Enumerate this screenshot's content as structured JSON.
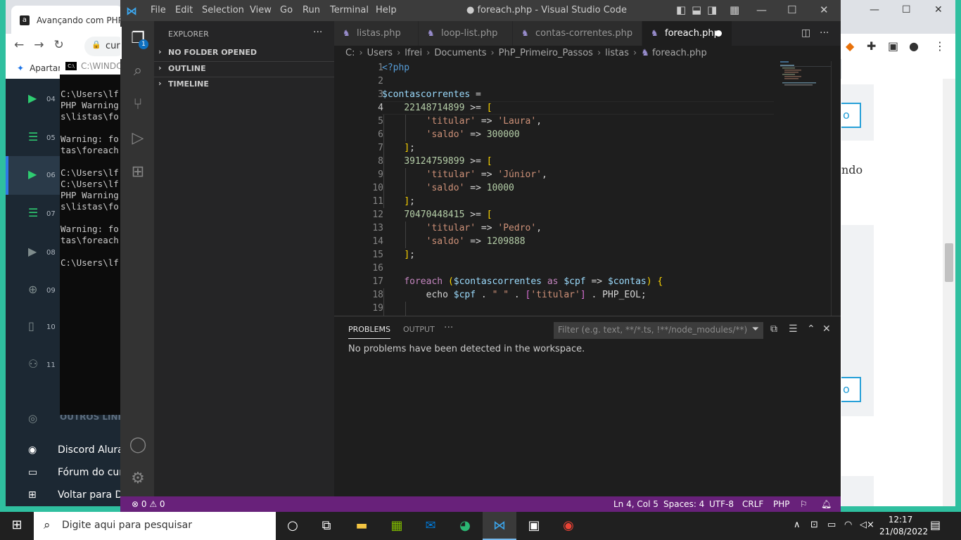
{
  "browser": {
    "tab_title": "Avançando com PHP: A",
    "tab_favicon": "a",
    "omnibox_text": "cur",
    "bookmark": "Apartar",
    "page_button": "o",
    "page_text": "ndo"
  },
  "course_sidebar": {
    "items": [
      {
        "num": "04",
        "icon": "play-icon"
      },
      {
        "num": "05",
        "icon": "list-icon"
      },
      {
        "num": "06",
        "icon": "play-icon"
      },
      {
        "num": "07",
        "icon": "list-icon"
      },
      {
        "num": "08",
        "icon": "play-icon"
      },
      {
        "num": "09",
        "icon": "plus-icon"
      },
      {
        "num": "10",
        "icon": "book-icon"
      },
      {
        "num": "11",
        "icon": "users-icon"
      }
    ],
    "outros": "OUTROS LINK",
    "links": [
      {
        "label": "Discord Alura",
        "icon": "discord-icon"
      },
      {
        "label": "Fórum do cur",
        "icon": "forum-icon"
      },
      {
        "label": "Voltar para Da",
        "icon": "dashboard-icon"
      }
    ]
  },
  "cmd": {
    "title": "C:\\WINDO",
    "lines": [
      "C:\\Users\\lf",
      "PHP Warning",
      "s\\listas\\fo",
      "",
      "Warning: fo",
      "tas\\foreach",
      "",
      "C:\\Users\\lf",
      "C:\\Users\\lf",
      "PHP Warning",
      "s\\listas\\fo",
      "",
      "Warning: fo",
      "tas\\foreach",
      "",
      "C:\\Users\\lf"
    ]
  },
  "vscode": {
    "window_title": "● foreach.php - Visual Studio Code",
    "menu": [
      "File",
      "Edit",
      "Selection",
      "View",
      "Go",
      "Run",
      "Terminal",
      "Help"
    ],
    "activity_badge": "1",
    "explorer_title": "EXPLORER",
    "sections": [
      "NO FOLDER OPENED",
      "OUTLINE",
      "TIMELINE"
    ],
    "tabs": [
      {
        "label": "listas.php"
      },
      {
        "label": "loop-list.php"
      },
      {
        "label": "contas-correntes.php"
      },
      {
        "label": "foreach.php"
      }
    ],
    "breadcrumb": [
      "C:",
      "Users",
      "lfrei",
      "Documents",
      "PhP_Primeiro_Passos",
      "listas",
      "foreach.php"
    ],
    "line_numbers": [
      "1",
      "2",
      "3",
      "4",
      "5",
      "6",
      "7",
      "8",
      "9",
      "10",
      "11",
      "12",
      "13",
      "14",
      "15",
      "16",
      "17",
      "18",
      "19"
    ],
    "code": {
      "l1": "<?php",
      "l3a": "$contascorrentes",
      "l3b": " =",
      "l4a": "22148714899",
      "l4b": " >= ",
      "l4c": "[",
      "l5a": "'titular'",
      "l5b": " => ",
      "l5c": "'Laura'",
      "l5d": ",",
      "l6a": "'saldo'",
      "l6b": " => ",
      "l6c": "300000",
      "l7a": "]",
      "l7b": ";",
      "l8a": "39124759899",
      "l8b": " >= ",
      "l8c": "[",
      "l9a": "'titular'",
      "l9b": " => ",
      "l9c": "'Júnior'",
      "l9d": ",",
      "l10a": "'saldo'",
      "l10b": " => ",
      "l10c": "10000",
      "l11a": "]",
      "l11b": ";",
      "l12a": "70470448415",
      "l12b": " >= ",
      "l12c": "[",
      "l13a": "'titular'",
      "l13b": " => ",
      "l13c": "'Pedro'",
      "l13d": ",",
      "l14a": "'saldo'",
      "l14b": " => ",
      "l14c": "1209888",
      "l15a": "]",
      "l15b": ";",
      "l17a": "foreach",
      "l17b": " ",
      "l17c": "(",
      "l17d": "$contascorrentes",
      "l17e": " as ",
      "l17f": "$cpf",
      "l17g": " => ",
      "l17h": "$contas",
      "l17i": ")",
      "l17j": " ",
      "l17k": "{",
      "l18a": "echo ",
      "l18b": "$cpf",
      "l18c": " . ",
      "l18d": "\" \"",
      "l18e": " . ",
      "l18f": "[",
      "l18g": "'titular'",
      "l18h": "]",
      "l18i": " . PHP_EOL;"
    },
    "panel": {
      "tabs": [
        "PROBLEMS",
        "OUTPUT"
      ],
      "filter_placeholder": "Filter (e.g. text, **/*.ts, !**/node_modules/**)",
      "message": "No problems have been detected in the workspace."
    },
    "status": {
      "errors": "⊗ 0 ⚠ 0",
      "position": "Ln 4, Col 5",
      "spaces": "Spaces: 4",
      "encoding": "UTF-8",
      "eol": "CRLF",
      "language": "PHP"
    }
  },
  "taskbar": {
    "search_placeholder": "Digite aqui para pesquisar",
    "time": "12:17",
    "date": "21/08/2022"
  }
}
